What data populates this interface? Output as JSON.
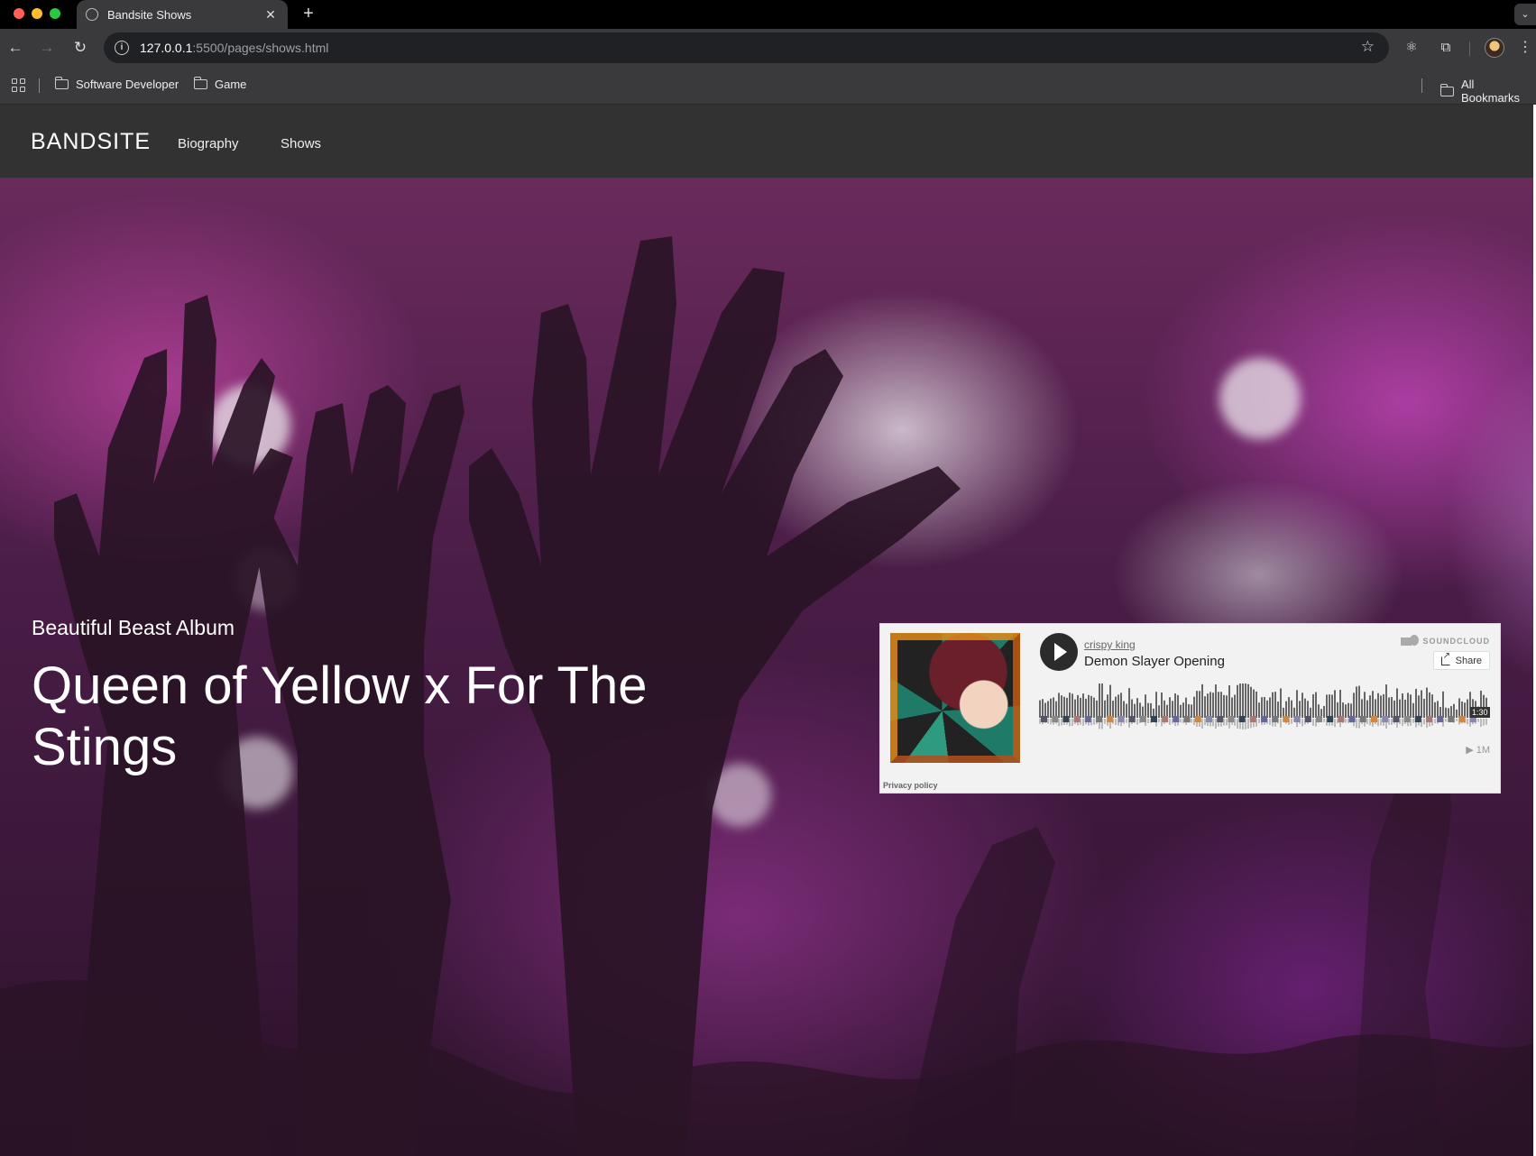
{
  "browser": {
    "tab_title": "Bandsite Shows",
    "new_tab_label": "+",
    "url_host": "127.0.0.1",
    "url_rest": ":5500/pages/shows.html",
    "bookmarks": [
      "Software Developer",
      "Game"
    ],
    "all_bookmarks": "All Bookmarks"
  },
  "site": {
    "logo": "BANDSITE",
    "nav": [
      "Biography",
      "Shows"
    ]
  },
  "hero": {
    "album_label": "Beautiful Beast Album",
    "album_title": "Queen of Yellow x For The Stings"
  },
  "soundcloud": {
    "user": "crispy king",
    "track": "Demon Slayer Opening",
    "brand": "SOUNDCLOUD",
    "share_label": "Share",
    "duration": "1:30",
    "plays": "1M",
    "privacy": "Privacy policy",
    "played_fraction": 0.0
  },
  "colors": {
    "nav_bg": "#323232",
    "chrome_bg": "#3a3a3c",
    "hero_tint": "#6a2a5c"
  },
  "icons": [
    "globe-icon",
    "close-icon",
    "back-icon",
    "forward-icon",
    "reload-icon",
    "info-icon",
    "star-icon",
    "extension-icon",
    "puzzle-icon",
    "kebab-icon",
    "apps-icon",
    "folder-icon",
    "play-icon",
    "soundcloud-icon",
    "share-icon"
  ]
}
